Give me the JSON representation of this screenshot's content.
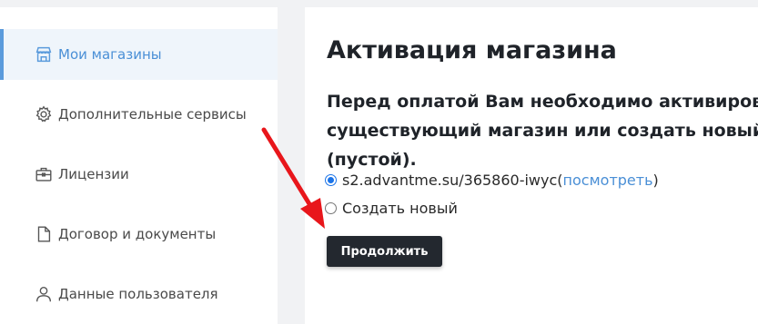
{
  "sidebar": {
    "items": [
      {
        "label": "Мои магазины",
        "icon": "store-icon",
        "active": true
      },
      {
        "label": "Дополнительные сервисы",
        "icon": "gear-icon",
        "active": false
      },
      {
        "label": "Лицензии",
        "icon": "briefcase-icon",
        "active": false
      },
      {
        "label": "Договор и документы",
        "icon": "document-icon",
        "active": false
      },
      {
        "label": "Данные пользователя",
        "icon": "user-icon",
        "active": false
      }
    ]
  },
  "main": {
    "title": "Активация магазина",
    "subtitle": "Перед оплатой Вам необходимо активировать существующий магазин или создать новый (пустой).",
    "options": [
      {
        "label": "s2.advantme.su/365860-iwyc",
        "link_open": " (",
        "link": "посмотреть",
        "link_close": ")",
        "checked": true
      },
      {
        "label": "Создать новый",
        "checked": false
      }
    ],
    "continue_label": "Продолжить"
  },
  "colors": {
    "accent": "#4a8fd6",
    "button_bg": "#23282f",
    "arrow": "#e8161b"
  }
}
